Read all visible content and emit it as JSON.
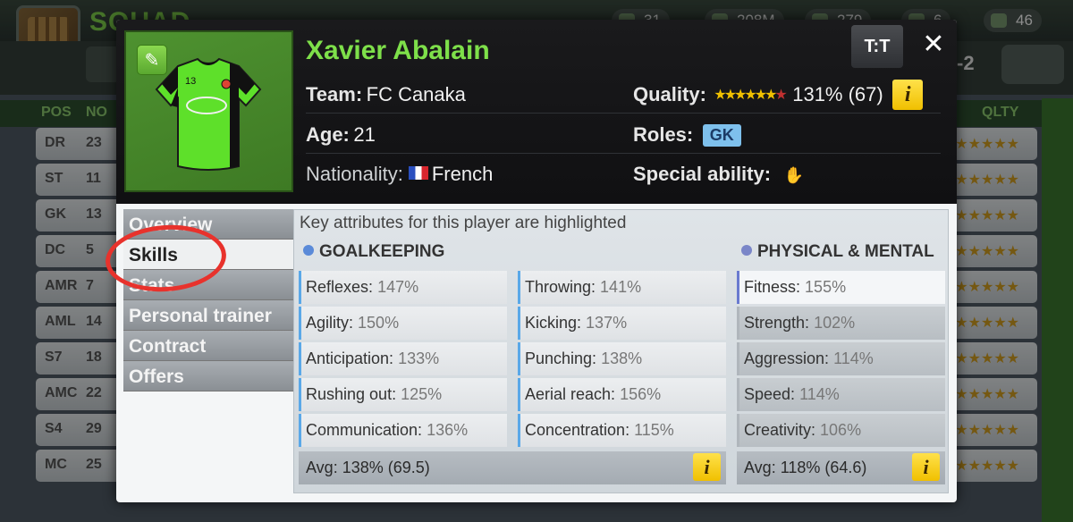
{
  "background": {
    "screen_title": "SQUAD",
    "stats": [
      "31",
      "208M",
      "279",
      "6",
      "46"
    ],
    "score": "-2",
    "columns": [
      "POS",
      "NO",
      "QLTY"
    ],
    "rows": [
      {
        "pos": "DR",
        "no": "23"
      },
      {
        "pos": "ST",
        "no": "11"
      },
      {
        "pos": "GK",
        "no": "13"
      },
      {
        "pos": "DC",
        "no": "5"
      },
      {
        "pos": "AMR",
        "no": "7"
      },
      {
        "pos": "AML",
        "no": "14"
      },
      {
        "pos": "S7",
        "no": "18"
      },
      {
        "pos": "AMC",
        "no": "22"
      },
      {
        "pos": "S4",
        "no": "29"
      },
      {
        "pos": "MC",
        "no": "25"
      }
    ]
  },
  "player": {
    "name": "Xavier Abalain",
    "jersey_number": "13",
    "team_label": "Team:",
    "team": "FC Canaka",
    "age_label": "Age:",
    "age": "21",
    "nationality_label": "Nationality:",
    "nationality": "French",
    "quality_label": "Quality:",
    "quality": "131% (67)",
    "roles_label": "Roles:",
    "role": "GK",
    "special_label": "Special ability:"
  },
  "header_buttons": {
    "shirt": "T:T",
    "close": "✕"
  },
  "tabs": [
    {
      "label": "Overview"
    },
    {
      "label": "Skills"
    },
    {
      "label": "Stats"
    },
    {
      "label": "Personal trainer"
    },
    {
      "label": "Contract"
    },
    {
      "label": "Offers"
    }
  ],
  "skills": {
    "hint": "Key attributes for this player are highlighted",
    "goalkeeping_title": "GOALKEEPING",
    "physical_title": "PHYSICAL & MENTAL",
    "gk_col1": [
      {
        "name": "Reflexes:",
        "value": "147%"
      },
      {
        "name": "Agility:",
        "value": "150%"
      },
      {
        "name": "Anticipation:",
        "value": "133%"
      },
      {
        "name": "Rushing out:",
        "value": "125%"
      },
      {
        "name": "Communication:",
        "value": "136%"
      }
    ],
    "gk_col2": [
      {
        "name": "Throwing:",
        "value": "141%"
      },
      {
        "name": "Kicking:",
        "value": "137%"
      },
      {
        "name": "Punching:",
        "value": "138%"
      },
      {
        "name": "Aerial reach:",
        "value": "156%"
      },
      {
        "name": "Concentration:",
        "value": "115%"
      }
    ],
    "phys": [
      {
        "name": "Fitness:",
        "value": "155%"
      },
      {
        "name": "Strength:",
        "value": "102%"
      },
      {
        "name": "Aggression:",
        "value": "114%"
      },
      {
        "name": "Speed:",
        "value": "114%"
      },
      {
        "name": "Creativity:",
        "value": "106%"
      }
    ],
    "gk_avg": "Avg: 138% (69.5)",
    "phys_avg": "Avg: 118% (64.6)",
    "info_glyph": "i"
  },
  "colors": {
    "name_green": "#7ee04a",
    "highlight_circle": "#e8322c",
    "info_yellow": "#f0c000",
    "role_badge": "#7ec0ec"
  }
}
